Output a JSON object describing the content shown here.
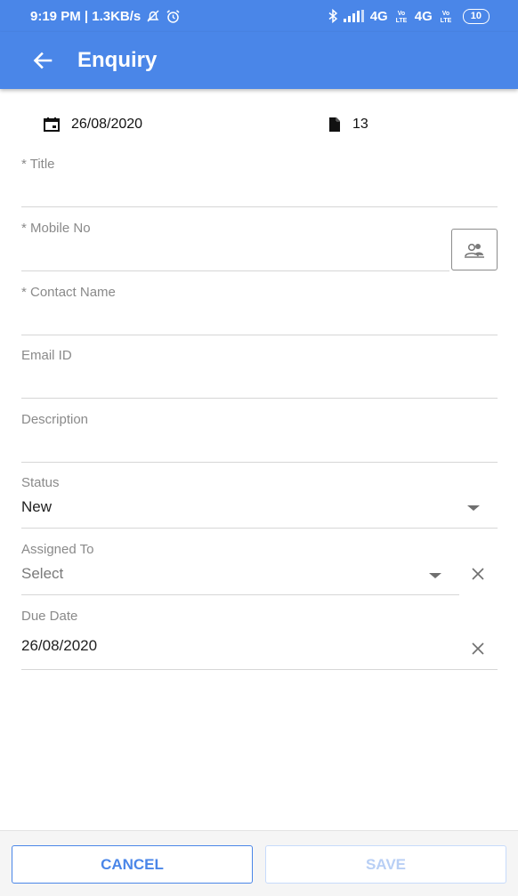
{
  "status_bar": {
    "time_speed": "9:19 PM | 1.3KB/s",
    "network": "4G",
    "network2": "4G",
    "battery": "10"
  },
  "app_bar": {
    "title": "Enquiry"
  },
  "meta": {
    "date": "26/08/2020",
    "count": "13"
  },
  "fields": {
    "title": {
      "label": "* Title",
      "value": ""
    },
    "mobile": {
      "label": "* Mobile No",
      "value": ""
    },
    "contact_name": {
      "label": "* Contact Name",
      "value": ""
    },
    "email": {
      "label": "Email ID",
      "value": ""
    },
    "description": {
      "label": "Description",
      "value": ""
    },
    "status": {
      "label": "Status",
      "value": "New"
    },
    "assigned_to": {
      "label": "Assigned To",
      "placeholder": "Select"
    },
    "due_date": {
      "label": "Due Date",
      "value": "26/08/2020"
    }
  },
  "buttons": {
    "cancel": "CANCEL",
    "save": "SAVE"
  },
  "colors": {
    "primary": "#4a86e8",
    "label_gray": "#8a8a8a",
    "divider": "#d6d6d6",
    "save_disabled": "#b8cff5"
  }
}
